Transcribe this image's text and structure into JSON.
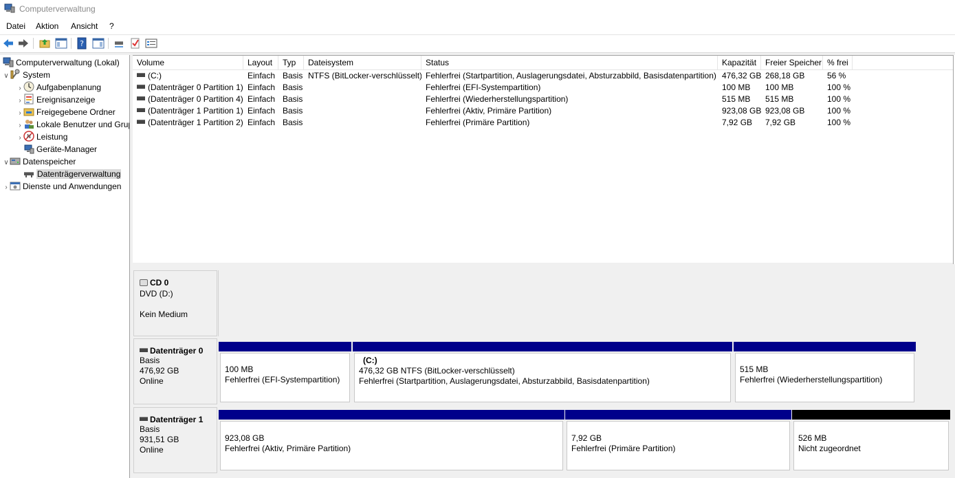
{
  "window": {
    "title": "Computerverwaltung"
  },
  "menu": [
    "Datei",
    "Aktion",
    "Ansicht",
    "?"
  ],
  "toolbar": {
    "icons": [
      "back-icon",
      "forward-icon",
      "up-folder-icon",
      "show-hide-tree-icon",
      "help-icon",
      "action-pane-icon",
      "connect-icon",
      "check-icon",
      "properties-icon"
    ]
  },
  "tree": {
    "root": "Computerverwaltung (Lokal)",
    "system": "System",
    "system_items": [
      "Aufgabenplanung",
      "Ereignisanzeige",
      "Freigegebene Ordner",
      "Lokale Benutzer und Gruppen",
      "Leistung",
      "Geräte-Manager"
    ],
    "storage": "Datenspeicher",
    "storage_items": [
      "Datenträgerverwaltung"
    ],
    "services": "Dienste und Anwendungen"
  },
  "volume_list": {
    "columns": [
      "Volume",
      "Layout",
      "Typ",
      "Dateisystem",
      "Status",
      "Kapazität",
      "Freier Speicher",
      "% frei"
    ],
    "rows": [
      [
        "(C:)",
        "Einfach",
        "Basis",
        "NTFS (BitLocker-verschlüsselt)",
        "Fehlerfrei (Startpartition, Auslagerungsdatei, Absturzabbild, Basisdatenpartition)",
        "476,32 GB",
        "268,18 GB",
        "56 %"
      ],
      [
        "(Datenträger 0 Partition 1)",
        "Einfach",
        "Basis",
        "",
        "Fehlerfrei (EFI-Systempartition)",
        "100 MB",
        "100 MB",
        "100 %"
      ],
      [
        "(Datenträger 0 Partition 4)",
        "Einfach",
        "Basis",
        "",
        "Fehlerfrei (Wiederherstellungspartition)",
        "515 MB",
        "515 MB",
        "100 %"
      ],
      [
        "(Datenträger 1 Partition 1)",
        "Einfach",
        "Basis",
        "",
        "Fehlerfrei (Aktiv, Primäre Partition)",
        "923,08 GB",
        "923,08 GB",
        "100 %"
      ],
      [
        "(Datenträger 1 Partition 2)",
        "Einfach",
        "Basis",
        "",
        "Fehlerfrei (Primäre Partition)",
        "7,92 GB",
        "7,92 GB",
        "100 %"
      ]
    ]
  },
  "disks": {
    "cd0": {
      "name": "CD 0",
      "type": "DVD (D:)",
      "status": "Kein Medium"
    },
    "disk0": {
      "name": "Datenträger 0",
      "type": "Basis",
      "size": "476,92 GB",
      "status": "Online",
      "partitions": [
        {
          "name": "",
          "size": "100 MB",
          "status": "Fehlerfrei (EFI-Systempartition)"
        },
        {
          "name": "(C:)",
          "size": "476,32 GB NTFS (BitLocker-verschlüsselt)",
          "status": "Fehlerfrei (Startpartition, Auslagerungsdatei, Absturzabbild, Basisdatenpartition)"
        },
        {
          "name": "",
          "size": "515 MB",
          "status": "Fehlerfrei (Wiederherstellungspartition)"
        }
      ]
    },
    "disk1": {
      "name": "Datenträger 1",
      "type": "Basis",
      "size": "931,51 GB",
      "status": "Online",
      "partitions": [
        {
          "name": "",
          "size": "923,08 GB",
          "status": "Fehlerfrei (Aktiv, Primäre Partition)"
        },
        {
          "name": "",
          "size": "7,92 GB",
          "status": "Fehlerfrei (Primäre Partition)"
        },
        {
          "name": "",
          "size": "526 MB",
          "status": "Nicht zugeordnet"
        }
      ]
    }
  },
  "colors": {
    "primary_partition_bar": "#00008b",
    "unallocated_bar": "#000000",
    "selection": "#d9d9d9"
  }
}
